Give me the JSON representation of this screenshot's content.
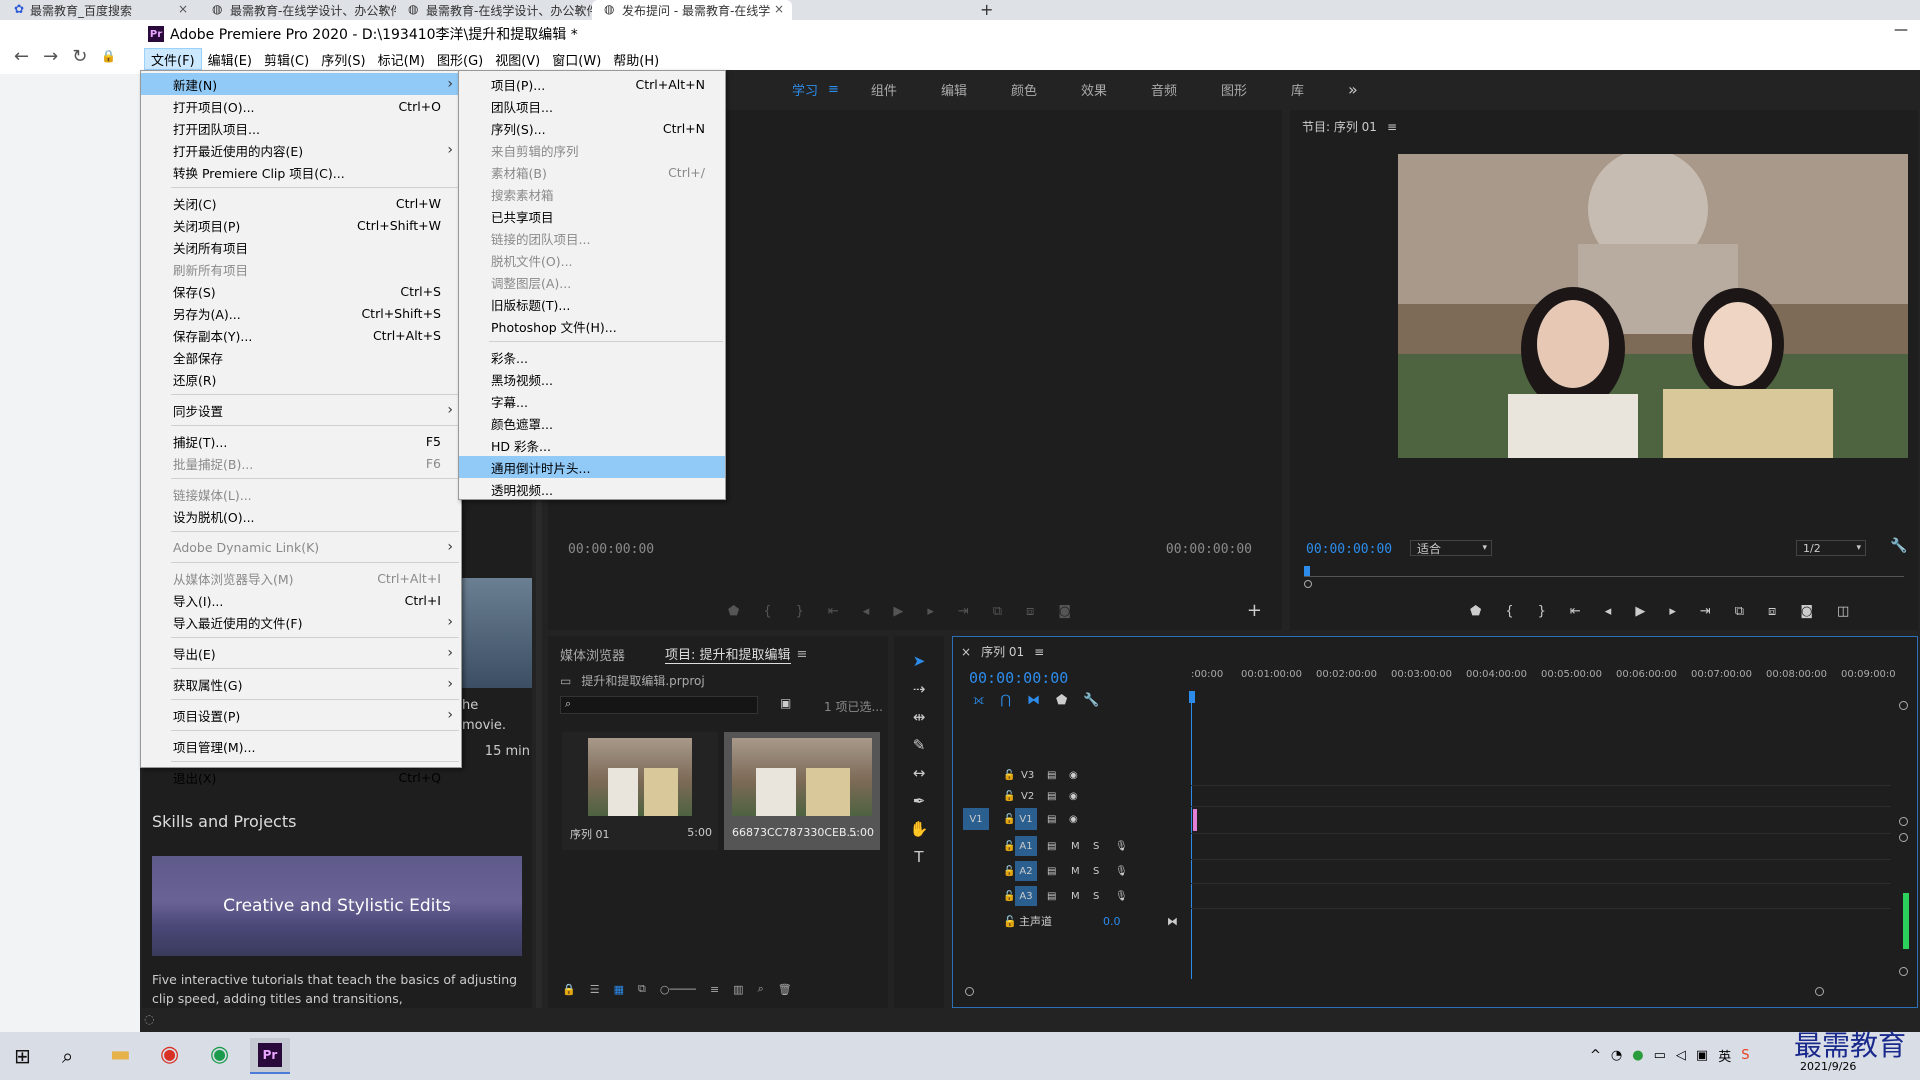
{
  "browser": {
    "tabs": [
      {
        "label": "最需教育_百度搜索",
        "close": "×"
      },
      {
        "label": "最需教育-在线学设计、办公软件",
        "close": "×"
      },
      {
        "label": "最需教育-在线学设计、办公软件",
        "close": "×"
      },
      {
        "label": "发布提问 - 最需教育-在线学",
        "close": "×"
      }
    ],
    "new_tab": "+",
    "nav": {
      "back": "←",
      "forward": "→",
      "reload": "↻"
    }
  },
  "app": {
    "icon_text": "Pr",
    "title": "Adobe Premiere Pro 2020 - D:\\193410李洋\\提升和提取编辑 *",
    "minimize": "—"
  },
  "menubar": [
    "文件(F)",
    "编辑(E)",
    "剪辑(C)",
    "序列(S)",
    "标记(M)",
    "图形(G)",
    "视图(V)",
    "窗口(W)",
    "帮助(H)"
  ],
  "workspaces": {
    "items": [
      "学习",
      "组件",
      "编辑",
      "颜色",
      "效果",
      "音频",
      "图形",
      "库"
    ],
    "active": "学习",
    "more": "»",
    "menu": "≡"
  },
  "file_menu": [
    {
      "label": "新建(N)",
      "shortcut": "",
      "arrow": "›",
      "hl": true
    },
    {
      "label": "打开项目(O)...",
      "shortcut": "Ctrl+O"
    },
    {
      "label": "打开团队项目...",
      "shortcut": ""
    },
    {
      "label": "打开最近使用的内容(E)",
      "shortcut": "",
      "arrow": "›"
    },
    {
      "label": "转换 Premiere Clip 项目(C)...",
      "shortcut": ""
    },
    {
      "sep": true
    },
    {
      "label": "关闭(C)",
      "shortcut": "Ctrl+W"
    },
    {
      "label": "关闭项目(P)",
      "shortcut": "Ctrl+Shift+W"
    },
    {
      "label": "关闭所有项目",
      "shortcut": ""
    },
    {
      "label": "刷新所有项目",
      "shortcut": "",
      "dis": true
    },
    {
      "label": "保存(S)",
      "shortcut": "Ctrl+S"
    },
    {
      "label": "另存为(A)...",
      "shortcut": "Ctrl+Shift+S"
    },
    {
      "label": "保存副本(Y)...",
      "shortcut": "Ctrl+Alt+S"
    },
    {
      "label": "全部保存",
      "shortcut": ""
    },
    {
      "label": "还原(R)",
      "shortcut": ""
    },
    {
      "sep": true
    },
    {
      "label": "同步设置",
      "shortcut": "",
      "arrow": "›"
    },
    {
      "sep": true
    },
    {
      "label": "捕捉(T)...",
      "shortcut": "F5"
    },
    {
      "label": "批量捕捉(B)...",
      "shortcut": "F6",
      "dis": true
    },
    {
      "sep": true
    },
    {
      "label": "链接媒体(L)...",
      "shortcut": "",
      "dis": true
    },
    {
      "label": "设为脱机(O)...",
      "shortcut": ""
    },
    {
      "sep": true
    },
    {
      "label": "Adobe Dynamic Link(K)",
      "shortcut": "",
      "arrow": "›",
      "dis": true
    },
    {
      "sep": true
    },
    {
      "label": "从媒体浏览器导入(M)",
      "shortcut": "Ctrl+Alt+I",
      "dis": true
    },
    {
      "label": "导入(I)...",
      "shortcut": "Ctrl+I"
    },
    {
      "label": "导入最近使用的文件(F)",
      "shortcut": "",
      "arrow": "›"
    },
    {
      "sep": true
    },
    {
      "label": "导出(E)",
      "shortcut": "",
      "arrow": "›"
    },
    {
      "sep": true
    },
    {
      "label": "获取属性(G)",
      "shortcut": "",
      "arrow": "›"
    },
    {
      "sep": true
    },
    {
      "label": "项目设置(P)",
      "shortcut": "",
      "arrow": "›"
    },
    {
      "sep": true
    },
    {
      "label": "项目管理(M)...",
      "shortcut": ""
    },
    {
      "sep": true
    },
    {
      "label": "退出(X)",
      "shortcut": "Ctrl+Q"
    }
  ],
  "new_submenu": [
    {
      "label": "项目(P)...",
      "shortcut": "Ctrl+Alt+N"
    },
    {
      "label": "团队项目...",
      "shortcut": ""
    },
    {
      "label": "序列(S)...",
      "shortcut": "Ctrl+N"
    },
    {
      "label": "来自剪辑的序列",
      "shortcut": "",
      "dis": true
    },
    {
      "label": "素材箱(B)",
      "shortcut": "Ctrl+/",
      "dis": true
    },
    {
      "label": "搜索素材箱",
      "shortcut": "",
      "dis": true
    },
    {
      "label": "已共享项目",
      "shortcut": ""
    },
    {
      "label": "链接的团队项目...",
      "shortcut": "",
      "dis": true
    },
    {
      "label": "脱机文件(O)...",
      "shortcut": "",
      "dis": true
    },
    {
      "label": "调整图层(A)...",
      "shortcut": "",
      "dis": true
    },
    {
      "label": "旧版标题(T)...",
      "shortcut": ""
    },
    {
      "label": "Photoshop 文件(H)...",
      "shortcut": ""
    },
    {
      "sep": true
    },
    {
      "label": "彩条...",
      "shortcut": ""
    },
    {
      "label": "黑场视频...",
      "shortcut": ""
    },
    {
      "label": "字幕...",
      "shortcut": ""
    },
    {
      "label": "颜色遮罩...",
      "shortcut": ""
    },
    {
      "label": "HD 彩条...",
      "shortcut": ""
    },
    {
      "label": "通用倒计时片头...",
      "shortcut": "",
      "hl": true
    },
    {
      "label": "透明视频...",
      "shortcut": ""
    }
  ],
  "learn_panel": {
    "partial_lines": [
      "he",
      "movie.",
      "15 min"
    ],
    "skills_heading": "Skills and Projects",
    "card_title": "Creative and Stylistic Edits",
    "card_desc": "Five interactive tutorials that teach the basics of adjusting clip speed, adding titles and transitions,"
  },
  "source_monitor": {
    "timecode_left": "00:00:00:00",
    "timecode_right": "00:00:00:00"
  },
  "program_monitor": {
    "title": "节目: 序列 01",
    "timecode": "00:00:00:00",
    "fit": "适合",
    "resolution": "1/2"
  },
  "project_panel": {
    "tabs": [
      "媒体浏览器",
      "项目: 提升和提取编辑"
    ],
    "active_tab": "项目: 提升和提取编辑",
    "project_file": "提升和提取编辑.prproj",
    "selected_count": "1 项已选...",
    "items": [
      {
        "name": "序列 01",
        "duration": "5:00"
      },
      {
        "name": "66873CC787330CEB...",
        "duration": "5:00"
      }
    ]
  },
  "timeline": {
    "close": "×",
    "tab": "序列 01",
    "timecode": "00:00:00:00",
    "ruler": [
      ":00:00",
      "00:01:00:00",
      "00:02:00:00",
      "00:03:00:00",
      "00:04:00:00",
      "00:05:00:00",
      "00:06:00:00",
      "00:07:00:00",
      "00:08:00:00",
      "00:09:00:0"
    ],
    "video_tracks": [
      "V3",
      "V2",
      "V1"
    ],
    "audio_tracks": [
      "A1",
      "A2",
      "A3"
    ],
    "source_v": "V1",
    "mute": "M",
    "solo": "S",
    "master": "主声道",
    "master_value": "0.0"
  },
  "tray": {
    "ime": "英",
    "watermark": "最需教育",
    "date": "2021/9/26"
  },
  "colors": {
    "accent": "#2d8ceb",
    "highlight": "#91c9f7",
    "panel": "#1e1e1e",
    "playhead": "#2d8ceb"
  }
}
